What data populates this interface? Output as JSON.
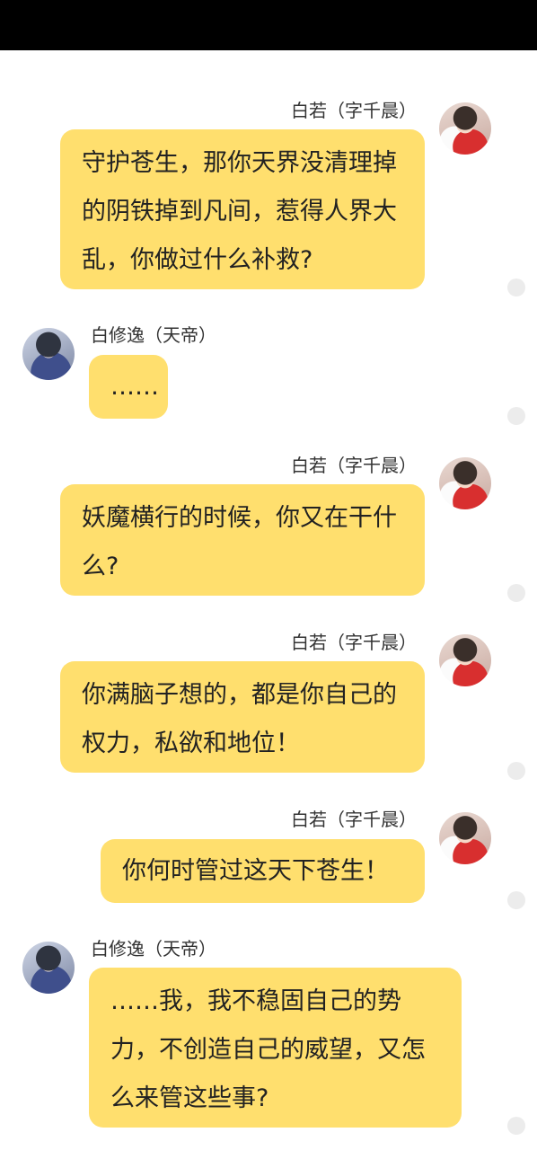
{
  "messages": [
    {
      "sender": "白若（字千晨）",
      "text": "守护苍生，那你天界没清理掉的阴铁掉到凡间，惹得人界大乱，你做过什么补救?"
    },
    {
      "sender": "白修逸（天帝）",
      "text": "……"
    },
    {
      "sender": "白若（字千晨）",
      "text": "妖魔横行的时候，你又在干什么?"
    },
    {
      "sender": "白若（字千晨）",
      "text": "你满脑子想的，都是你自己的权力，私欲和地位！"
    },
    {
      "sender": "白若（字千晨）",
      "text": "你何时管过这天下苍生！"
    },
    {
      "sender": "白修逸（天帝）",
      "text": "……我，我不稳固自己的势力，不创造自己的威望，又怎么来管这些事?"
    }
  ],
  "colors": {
    "bubble": "#ffdf6e",
    "topbar": "#000000",
    "dot": "#ececec"
  }
}
